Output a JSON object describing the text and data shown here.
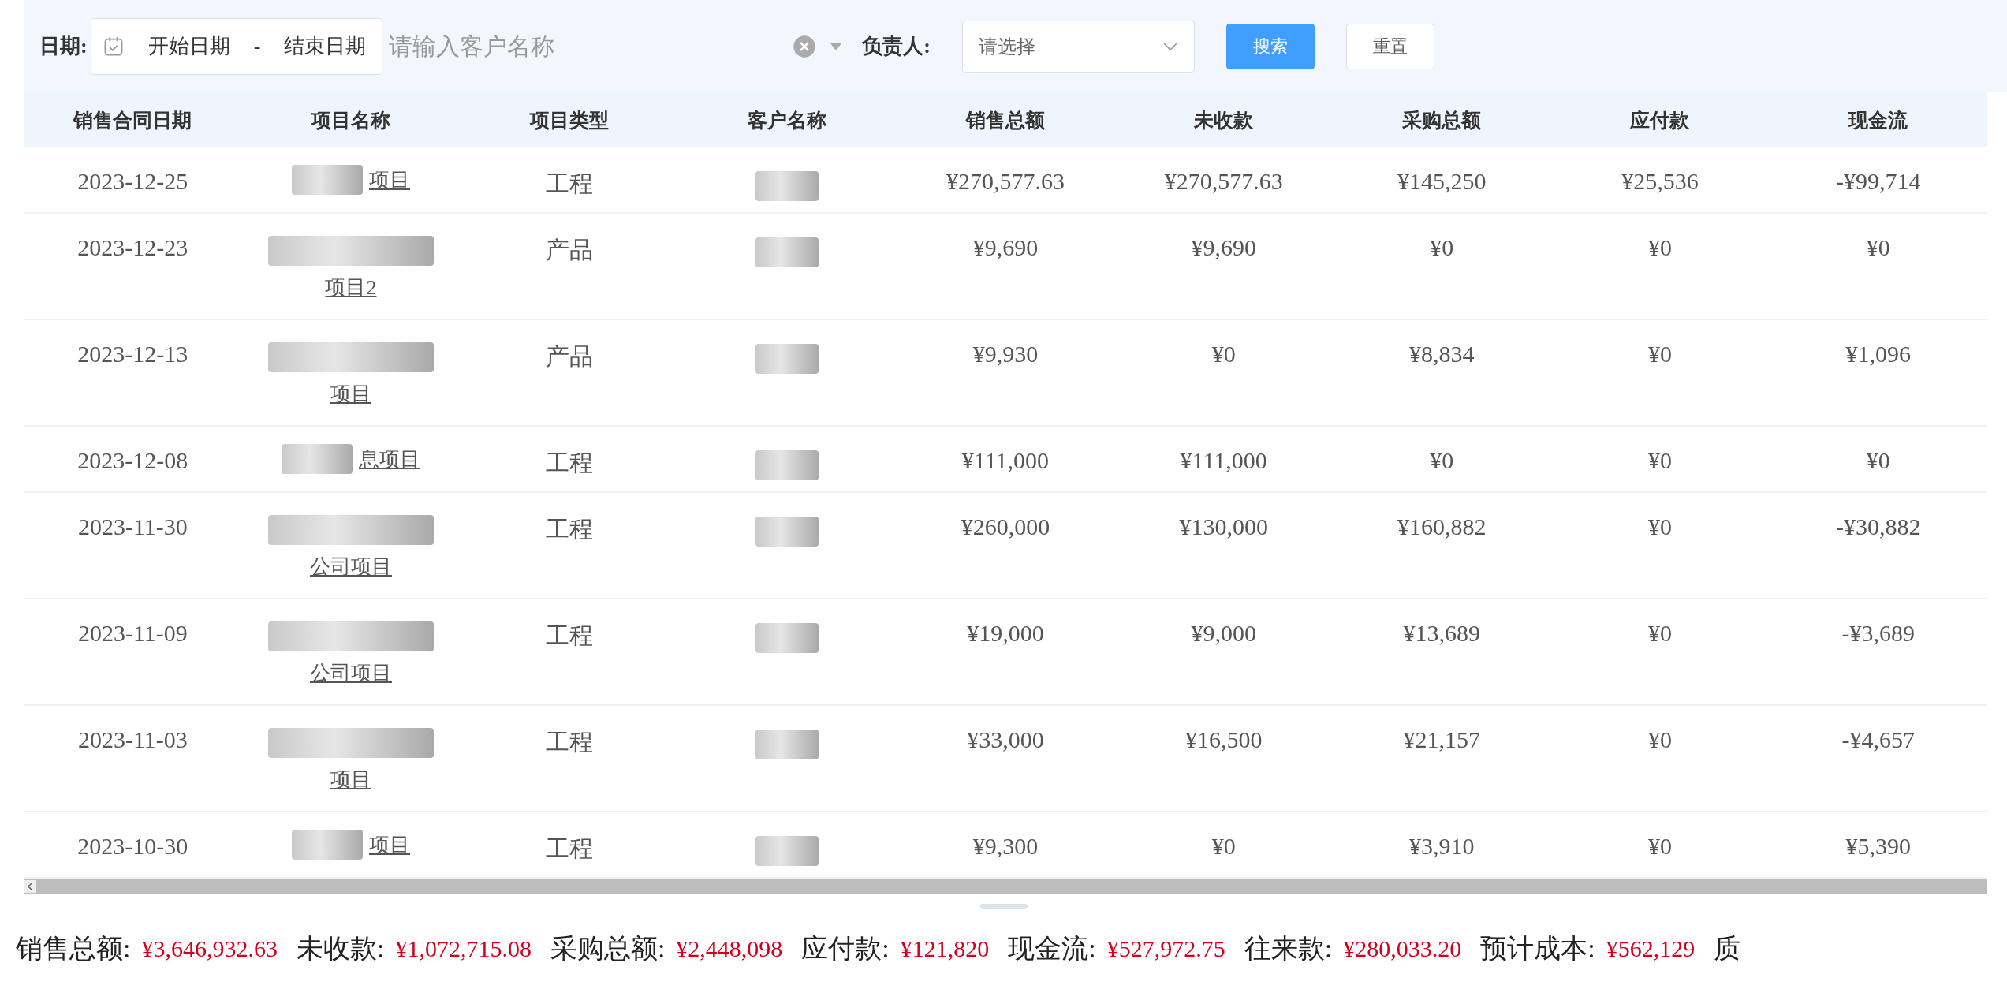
{
  "filters": {
    "date_label": "日期:",
    "start_placeholder": "开始日期",
    "separator": "-",
    "end_placeholder": "结束日期",
    "customer_placeholder": "请输入客户名称",
    "owner_label": "负责人:",
    "owner_placeholder": "请选择",
    "search_button": "搜索",
    "reset_button": "重置"
  },
  "table": {
    "columns": [
      "销售合同日期",
      "项目名称",
      "项目类型",
      "客户名称",
      "销售总额",
      "未收款",
      "采购总额",
      "应付款",
      "现金流"
    ],
    "rows": [
      {
        "date": "2023-12-25",
        "project": "项目",
        "project_wrapped": false,
        "type": "工程",
        "sales": "¥270,577.63",
        "unpaid": "¥270,577.63",
        "purchase": "¥145,250",
        "payable": "¥25,536",
        "cashflow": "-¥99,714"
      },
      {
        "date": "2023-12-23",
        "project": "项目2",
        "project_wrapped": true,
        "type": "产品",
        "sales": "¥9,690",
        "unpaid": "¥9,690",
        "purchase": "¥0",
        "payable": "¥0",
        "cashflow": "¥0"
      },
      {
        "date": "2023-12-13",
        "project": "项目",
        "project_wrapped": true,
        "type": "产品",
        "sales": "¥9,930",
        "unpaid": "¥0",
        "purchase": "¥8,834",
        "payable": "¥0",
        "cashflow": "¥1,096"
      },
      {
        "date": "2023-12-08",
        "project": "息项目",
        "project_wrapped": false,
        "type": "工程",
        "sales": "¥111,000",
        "unpaid": "¥111,000",
        "purchase": "¥0",
        "payable": "¥0",
        "cashflow": "¥0"
      },
      {
        "date": "2023-11-30",
        "project": "公司项目",
        "project_wrapped": true,
        "type": "工程",
        "sales": "¥260,000",
        "unpaid": "¥130,000",
        "purchase": "¥160,882",
        "payable": "¥0",
        "cashflow": "-¥30,882"
      },
      {
        "date": "2023-11-09",
        "project": "公司项目",
        "project_wrapped": true,
        "type": "工程",
        "sales": "¥19,000",
        "unpaid": "¥9,000",
        "purchase": "¥13,689",
        "payable": "¥0",
        "cashflow": "-¥3,689"
      },
      {
        "date": "2023-11-03",
        "project": "项目",
        "project_wrapped": true,
        "type": "工程",
        "sales": "¥33,000",
        "unpaid": "¥16,500",
        "purchase": "¥21,157",
        "payable": "¥0",
        "cashflow": "-¥4,657"
      },
      {
        "date": "2023-10-30",
        "project": "项目",
        "project_wrapped": false,
        "type": "工程",
        "sales": "¥9,300",
        "unpaid": "¥0",
        "purchase": "¥3,910",
        "payable": "¥0",
        "cashflow": "¥5,390"
      }
    ]
  },
  "summary": [
    {
      "label": "销售总额:",
      "value": "¥3,646,932.63"
    },
    {
      "label": "未收款:",
      "value": "¥1,072,715.08"
    },
    {
      "label": "采购总额:",
      "value": "¥2,448,098"
    },
    {
      "label": "应付款:",
      "value": "¥121,820"
    },
    {
      "label": "现金流:",
      "value": "¥527,972.75"
    },
    {
      "label": "往来款:",
      "value": "¥280,033.20"
    },
    {
      "label": "预计成本:",
      "value": "¥562,129"
    },
    {
      "label": "质"
    }
  ]
}
